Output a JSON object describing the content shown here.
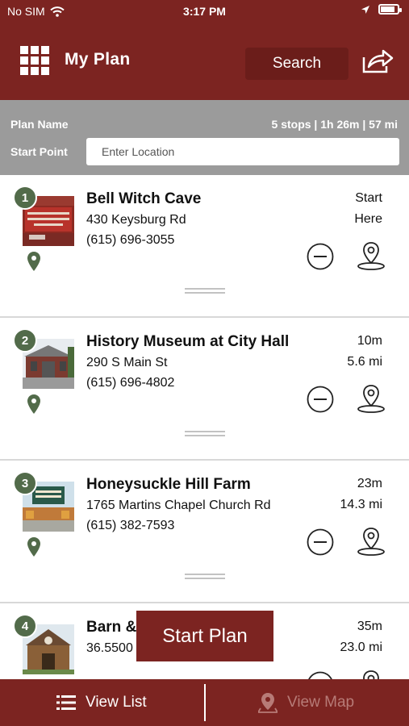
{
  "status": {
    "carrier": "No SIM",
    "time": "3:17 PM",
    "battery_level": 0.85
  },
  "header": {
    "title": "My Plan",
    "search_label": "Search",
    "menu_icon": "grid-icon",
    "share_icon": "share-icon"
  },
  "plan": {
    "name_label": "Plan Name",
    "stats": "5 stops | 1h 26m | 57 mi",
    "start_label": "Start Point",
    "start_placeholder": "Enter Location"
  },
  "stops": [
    {
      "number": "1",
      "name": "Bell Witch Cave",
      "address": "430 Keysburg Rd",
      "phone": "(615) 696-3055",
      "time": "Start",
      "distance": "Here"
    },
    {
      "number": "2",
      "name": "History Museum at City Hall",
      "address": "290 S Main St",
      "phone": "(615) 696-4802",
      "time": "10m",
      "distance": "5.6 mi"
    },
    {
      "number": "3",
      "name": "Honeysuckle Hill Farm",
      "address": "1765 Martins Chapel Church Rd",
      "phone": "(615) 382-7593",
      "time": "23m",
      "distance": "14.3 mi"
    },
    {
      "number": "4",
      "name": "Barn &",
      "address": "36.5500",
      "phone": "",
      "time": "35m",
      "distance": "23.0 mi"
    }
  ],
  "start_plan_label": "Start Plan",
  "tabs": {
    "list_label": "View List",
    "map_label": "View Map"
  },
  "colors": {
    "brand": "#7c2421",
    "badge": "#526b4a",
    "band": "#9b9b9b"
  }
}
